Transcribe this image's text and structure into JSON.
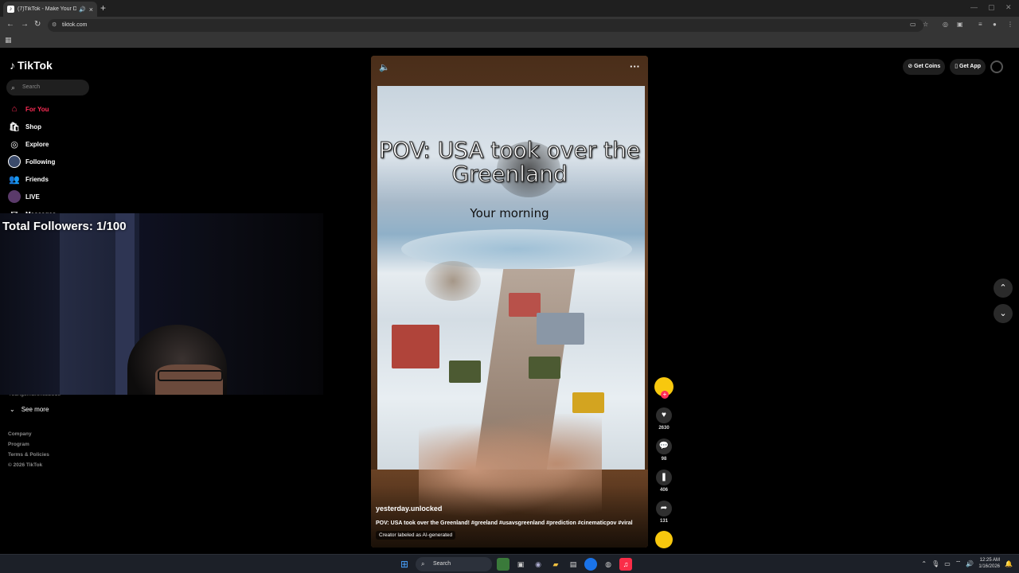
{
  "browser": {
    "tab_title": "(7)TikTok - Make Your Day",
    "url": "tiktok.com"
  },
  "sidebar": {
    "logo": "TikTok",
    "search_placeholder": "Search",
    "items": [
      {
        "label": "For You",
        "icon": "home-icon"
      },
      {
        "label": "Shop",
        "icon": "shop-icon"
      },
      {
        "label": "Explore",
        "icon": "compass-icon"
      },
      {
        "label": "Following",
        "icon": "following-avatar-icon"
      },
      {
        "label": "Friends",
        "icon": "friends-icon"
      },
      {
        "label": "LIVE",
        "icon": "live-icon"
      },
      {
        "label": "Messages",
        "icon": "messages-icon"
      }
    ],
    "account_partial": "rodrigomartinez2318",
    "see_more": "See more",
    "footer": [
      "Company",
      "Program",
      "Terms & Policies",
      "© 2026 TikTok"
    ]
  },
  "overlay": {
    "followers_text": "Total Followers: 1/100"
  },
  "video": {
    "title": "POV: USA took over the Greenland",
    "subtitle": "Your morning",
    "username": "yesterday.unlocked",
    "description": "POV: USA took over the Greenland! #greeland #usavsgreenland #prediction #cinematicpov #viral",
    "ai_label": "Creator labeled as AI-generated"
  },
  "actions": {
    "likes": "2630",
    "comments": "98",
    "saves": "406",
    "shares": "131"
  },
  "header_right": {
    "get_coins": "Get Coins",
    "get_app": "Get App"
  },
  "taskbar": {
    "search": "Search",
    "time": "12:25 AM",
    "date": "1/16/2026"
  }
}
